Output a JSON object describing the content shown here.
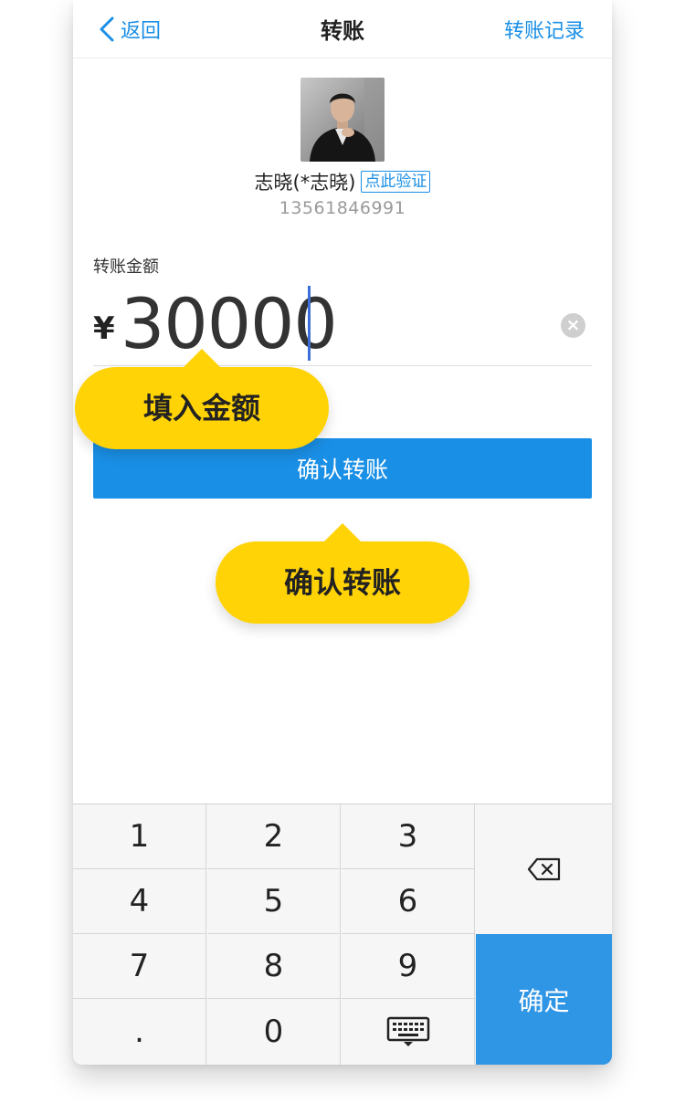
{
  "nav": {
    "back_label": "返回",
    "title": "转账",
    "right_label": "转账记录"
  },
  "recipient": {
    "name": "志晓(*志晓)",
    "verify_label": "点此验证",
    "phone": "13561846991"
  },
  "amount": {
    "label": "转账金额",
    "currency": "¥",
    "value": "30000"
  },
  "confirm_button": "确认转账",
  "callouts": {
    "amount": "填入金额",
    "confirm": "确认转账"
  },
  "keypad": {
    "keys": [
      "1",
      "2",
      "3",
      "4",
      "5",
      "6",
      "7",
      "8",
      "9",
      ".",
      "0"
    ],
    "confirm_label": "确定"
  },
  "colors": {
    "accent": "#1a8fe6",
    "callout": "#ffd305",
    "keypad_confirm": "#2f95e5"
  }
}
